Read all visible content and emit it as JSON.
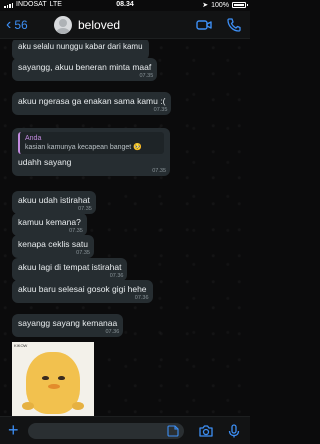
{
  "status_bar": {
    "carrier": "INDOSAT",
    "network": "LTE",
    "time": "08.34",
    "battery": "100%"
  },
  "header": {
    "back_count": "56",
    "contact_name": "beloved",
    "icons": [
      "back-chevron-icon",
      "video-call-icon",
      "phone-icon"
    ]
  },
  "messages": [
    {
      "text": "aku selalu nunggu kabar dari kamu",
      "time": ""
    },
    {
      "text": "sayangg, akuu beneran minta maaf",
      "time": "07.35"
    },
    {
      "text": "akuu ngerasa ga enakan sama kamu :(",
      "time": "07.35"
    },
    {
      "quote_author": "Anda",
      "quote_text": "kasian kamunya kecapean banget 🥺",
      "text": "udahh sayang",
      "time": "07.35"
    },
    {
      "text": "akuu udah istirahat",
      "time": "07.35"
    },
    {
      "text": "kamuu kemana?",
      "time": "07.35"
    },
    {
      "text": "kenapa ceklis satu",
      "time": "07.35"
    },
    {
      "text": "akuu lagi di tempat istirahat",
      "time": "07.36"
    },
    {
      "text": "akuu baru selesai gosok gigi hehe",
      "time": "07.36"
    },
    {
      "text": "sayangg sayang kemanaa",
      "time": "07.36"
    }
  ],
  "sticker": {
    "label": "KIKOW"
  },
  "input_bar": {
    "icons": [
      "plus-icon",
      "sticker-icon",
      "camera-icon",
      "microphone-icon"
    ]
  },
  "colors": {
    "accent": "#3d8ff5",
    "bubble": "#262d31",
    "quote_accent": "#c38be0",
    "background": "#0b0b0c"
  }
}
